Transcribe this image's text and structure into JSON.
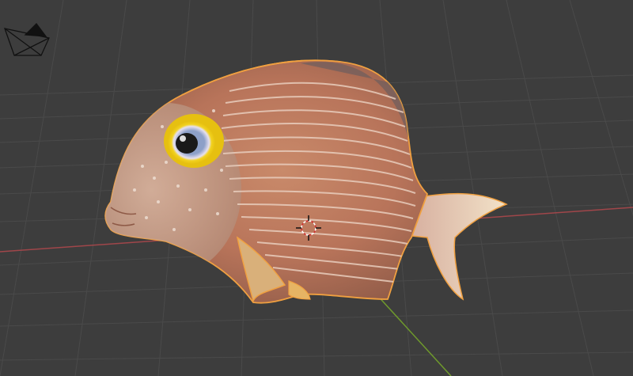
{
  "app": "3D viewport",
  "viewport": {
    "background_color": "#3d3d3d",
    "grid_line_color": "#4a4a4a",
    "x_axis_color": "#a0464a",
    "y_axis_color": "#6f9a2c",
    "selection_outline_color": "#f0a040"
  },
  "objects": [
    {
      "name": "camera",
      "icon": "camera-icon",
      "selected": false
    },
    {
      "name": "fish",
      "icon": "fish-mesh",
      "selected": true
    }
  ],
  "cursor": {
    "icon": "3d-cursor-icon"
  }
}
